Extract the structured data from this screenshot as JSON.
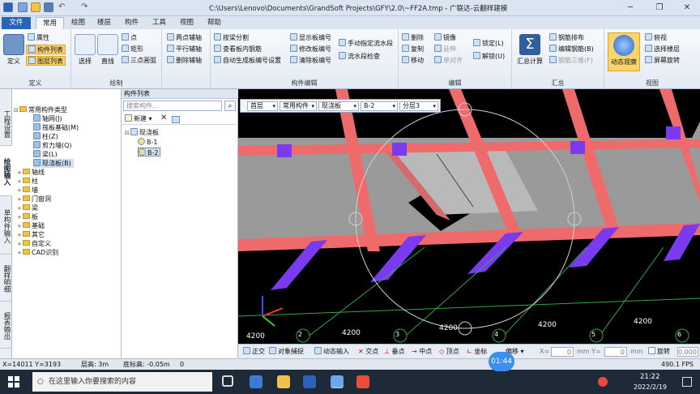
{
  "window": {
    "title": "C:\\Users\\Lenovo\\Documents\\GrandSoft Projects\\GFY\\2.0\\~FF2A.tmp - 广联达-云翻样建模"
  },
  "tabs": [
    "文件",
    "常用",
    "绘图",
    "楼层",
    "构件",
    "工具",
    "视图",
    "帮助"
  ],
  "ribbon": {
    "define": {
      "big": "定义",
      "items": [
        "属性",
        "构件列表",
        "图层列表"
      ],
      "label": "定义"
    },
    "draw": {
      "select": "选择",
      "line": "直线",
      "items": [
        "点",
        "矩形",
        "三点画弧"
      ],
      "label": "绘制"
    },
    "aux": {
      "items": [
        "两点辅轴",
        "平行辅轴",
        "删除辅轴"
      ]
    },
    "slab": {
      "items": [
        "按梁分割",
        "查看板内钢筋",
        "自动生成板编号设置",
        "显示板编号",
        "修改板编号",
        "清除板编号",
        "手动指定流水段",
        "流水段检查"
      ],
      "label": "构件编辑"
    },
    "edit": {
      "items": [
        "删除",
        "镜像",
        "复制",
        "延伸",
        "移动",
        "单对齐",
        "锁定(L)",
        "解锁(U)"
      ],
      "label": "编辑"
    },
    "calc": {
      "big": "汇总计算",
      "items": [
        "钢筋排布",
        "编辑钢筋(B)",
        "钢筋三维(F)"
      ],
      "label": "汇总"
    },
    "view": {
      "big": "动态观察",
      "items": [
        "俯视",
        "选择楼层",
        "屏幕旋转"
      ],
      "label": "视图"
    }
  },
  "lefttabs": [
    "工程设置",
    "绘图输入",
    "单构件输入",
    "翻样明细",
    "报表输出"
  ],
  "tree": {
    "root": "常用构件类型",
    "children": [
      "轴网(J)",
      "筏板基础(M)",
      "柱(Z)",
      "剪力墙(Q)",
      "梁(L)",
      "现浇板(B)"
    ],
    "folders": [
      "轴线",
      "柱",
      "墙",
      "门窗洞",
      "梁",
      "板",
      "基础",
      "其它",
      "自定义",
      "CAD识别"
    ]
  },
  "list": {
    "title": "构件列表",
    "search_placeholder": "搜索构件...",
    "new": "新建",
    "group": "现浇板",
    "items": [
      "B-1",
      "B-2"
    ]
  },
  "viewport": {
    "floor": "首层",
    "type": "常用构件",
    "sub": "现浇板",
    "item": "B-2",
    "layer": "分层3",
    "dims": [
      "4200",
      "4200",
      "4200",
      "4200",
      "4200"
    ],
    "axes": [
      "2",
      "3",
      "4",
      "5",
      "6"
    ]
  },
  "snap": [
    "正交",
    "对象捕捉",
    "动态输入",
    "交点",
    "垂点",
    "中点",
    "顶点",
    "坐标",
    "偏移",
    "X=",
    "0",
    "mm Y=",
    "0",
    "mm",
    "旋转",
    "0.000"
  ],
  "status": {
    "coords": "X=14011  Y=3193",
    "floor_h": "层高: 3m",
    "base_h": "底标高: -0.05m",
    "num": "0",
    "fps": "490.1 FPS"
  },
  "timer": "01:44",
  "taskbar": {
    "search": "在这里输入你要搜索的内容",
    "time": "21:22",
    "date": "2022/2/19"
  }
}
